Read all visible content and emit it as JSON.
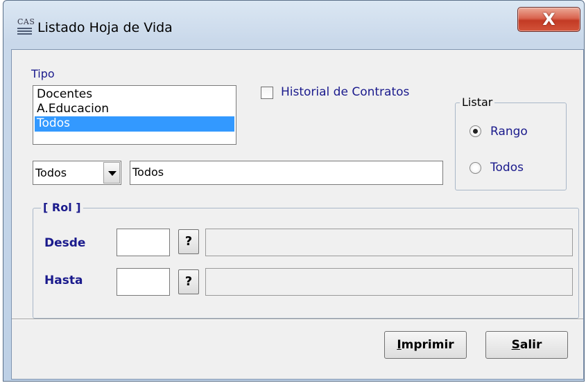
{
  "window": {
    "title": "Listado Hoja de Vida",
    "icon_text": "CAS",
    "close_label": "X"
  },
  "tipo": {
    "label": "Tipo",
    "items": [
      "Docentes",
      "A.Educacion",
      "Todos"
    ],
    "selected_index": 2
  },
  "historial": {
    "label": "Historial de Contratos",
    "checked": false
  },
  "listar": {
    "title": "Listar",
    "options": [
      {
        "label": "Rango",
        "selected": true
      },
      {
        "label": "Todos",
        "selected": false
      }
    ]
  },
  "filter": {
    "combo_value": "Todos",
    "text_value": "Todos"
  },
  "rol": {
    "title": "[ Rol ]",
    "desde_label": "Desde",
    "hasta_label": "Hasta",
    "desde_value": "",
    "hasta_value": "",
    "desde_desc": "",
    "hasta_desc": "",
    "lookup_label": "?"
  },
  "buttons": {
    "imprimir_first": "I",
    "imprimir_rest": "mprimir",
    "salir_first": "S",
    "salir_rest": "alir"
  }
}
